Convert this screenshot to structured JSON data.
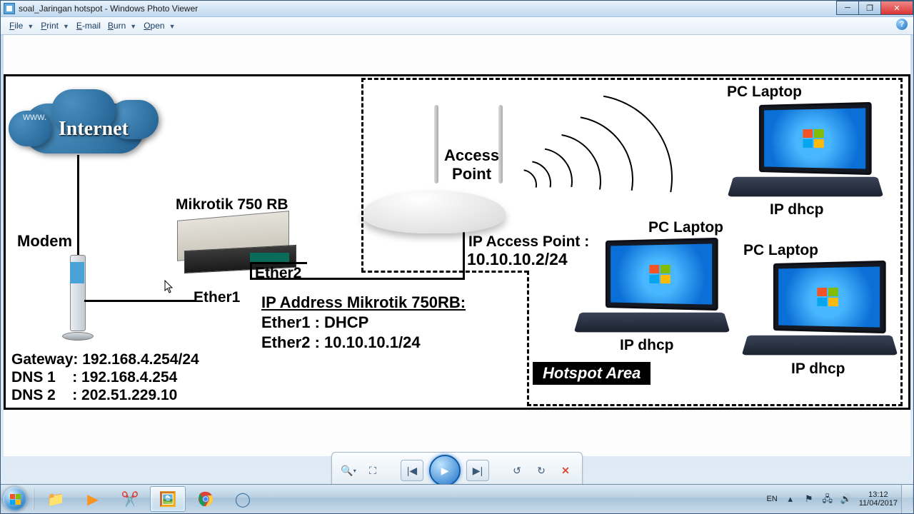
{
  "window": {
    "title": "soal_Jaringan hotspot - Windows Photo Viewer"
  },
  "menu": {
    "file": "File",
    "print": "Print",
    "email": "E-mail",
    "burn": "Burn",
    "open": "Open"
  },
  "diagram": {
    "cloud_www": "www.",
    "cloud_label": "Internet",
    "modem_label": "Modem",
    "modem_info": {
      "gateway": "Gateway: 192.168.4.254/24",
      "dns1": "DNS 1    : 192.168.4.254",
      "dns2": "DNS 2    : 202.51.229.10"
    },
    "router_label": "Mikrotik 750 RB",
    "ether1": "Ether1",
    "ether2": "Ether2",
    "router_ip_title": "IP Address Mikrotik 750RB:",
    "router_ip_e1": "Ether1 : DHCP",
    "router_ip_e2": "Ether2 : 10.10.10.1/24",
    "ap_label": "Access Point",
    "ap_ip_title": "IP Access Point :",
    "ap_ip": "10.10.10.2/24",
    "hotspot_label": "Hotspot Area",
    "pc_label": "PC Laptop",
    "ip_dhcp": "IP dhcp"
  },
  "toolbar": {
    "zoom": "🔍",
    "fit": "⛶",
    "prev": "|◀",
    "play": "▶",
    "next": "▶|",
    "ccw": "↺",
    "cw": "↻",
    "del": "✕"
  },
  "taskbar": {
    "lang": "EN",
    "time": "13:12",
    "date": "11/04/2017"
  }
}
